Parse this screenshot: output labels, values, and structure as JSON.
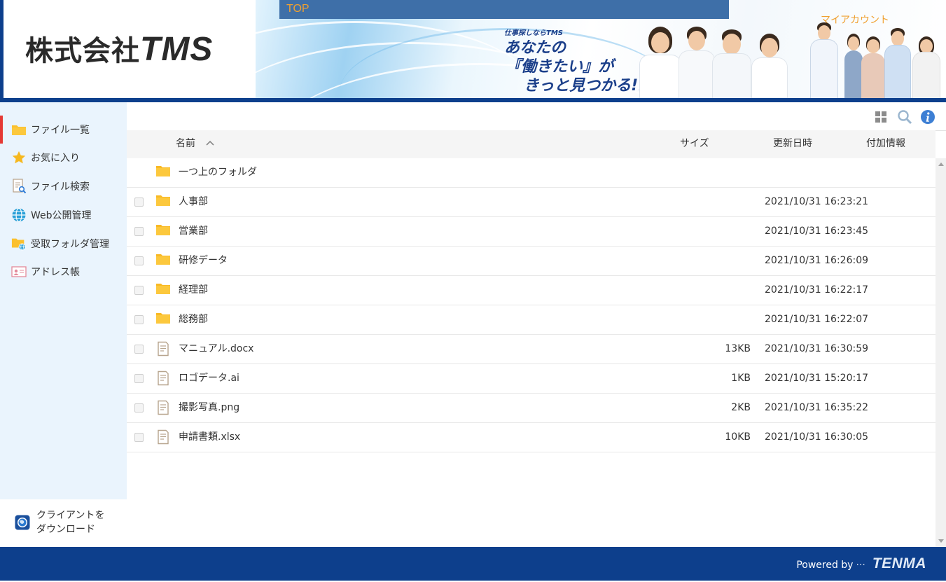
{
  "header": {
    "logo_jp": "株式会社",
    "logo_en": "TMS",
    "top_label": "TOP",
    "my_account": "マイアカウント",
    "catch_small": "仕事探しならTMS",
    "catch_line1": "あなたの",
    "catch_line2": "『働きたい』が",
    "catch_line3": "きっと見つかる!!"
  },
  "sidebar": {
    "items": [
      {
        "label": "ファイル一覧",
        "icon": "folder-icon"
      },
      {
        "label": "お気に入り",
        "icon": "star-icon"
      },
      {
        "label": "ファイル検索",
        "icon": "file-search-icon"
      },
      {
        "label": "Web公開管理",
        "icon": "globe-icon"
      },
      {
        "label": "受取フォルダ管理",
        "icon": "folder-globe-icon"
      },
      {
        "label": "アドレス帳",
        "icon": "address-card-icon"
      }
    ],
    "client_line1": "クライアントを",
    "client_line2": "ダウンロード"
  },
  "toolbar": {
    "icons": [
      "grid-view-icon",
      "search-icon",
      "info-icon"
    ]
  },
  "table": {
    "col_name": "名前",
    "col_size": "サイズ",
    "col_date": "更新日時",
    "col_extra": "付加情報",
    "parent_folder": "一つ上のフォルダ",
    "rows": [
      {
        "name": "人事部",
        "type": "folder",
        "size": "",
        "date": "2021/10/31 16:23:21"
      },
      {
        "name": "営業部",
        "type": "folder",
        "size": "",
        "date": "2021/10/31 16:23:45"
      },
      {
        "name": "研修データ",
        "type": "folder",
        "size": "",
        "date": "2021/10/31 16:26:09"
      },
      {
        "name": "経理部",
        "type": "folder",
        "size": "",
        "date": "2021/10/31 16:22:17"
      },
      {
        "name": "総務部",
        "type": "folder",
        "size": "",
        "date": "2021/10/31 16:22:07"
      },
      {
        "name": "マニュアル.docx",
        "type": "file",
        "size": "13KB",
        "date": "2021/10/31 16:30:59"
      },
      {
        "name": "ロゴデータ.ai",
        "type": "file",
        "size": "1KB",
        "date": "2021/10/31 15:20:17"
      },
      {
        "name": "撮影写真.png",
        "type": "file",
        "size": "2KB",
        "date": "2021/10/31 16:35:22"
      },
      {
        "name": "申請書類.xlsx",
        "type": "file",
        "size": "10KB",
        "date": "2021/10/31 16:30:05"
      }
    ]
  },
  "footer": {
    "powered": "Powered by",
    "brand": "TENMA"
  },
  "colors": {
    "brand_blue": "#0d3f8c",
    "accent_orange": "#f0a030",
    "folder_yellow": "#fbc02d",
    "active_marker": "#e53935"
  }
}
